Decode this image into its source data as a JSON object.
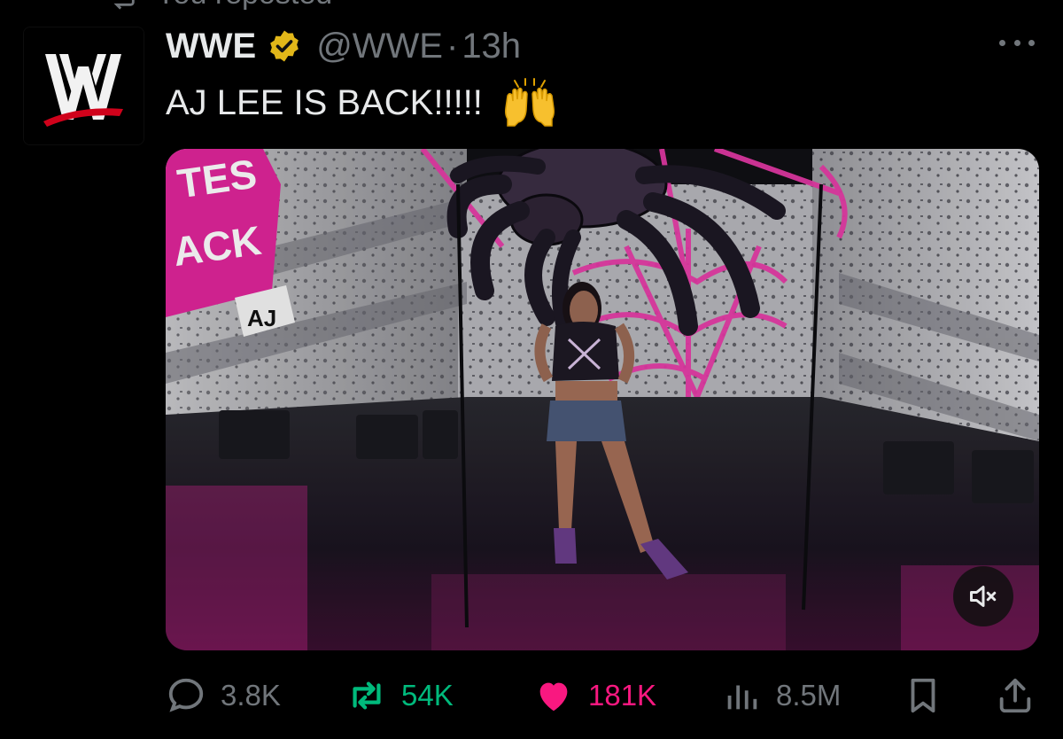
{
  "repost_banner": {
    "text": "You reposted"
  },
  "post": {
    "author_name": "WWE",
    "handle": "@WWE",
    "separator": "·",
    "time": "13h",
    "text": "AJ LEE IS BACK!!!!!",
    "emoji": "raising-hands",
    "media": {
      "type": "video",
      "muted": true,
      "sign_text_1": "TES",
      "sign_text_2": "ACK",
      "sign_text_3": "AJ"
    }
  },
  "actions": {
    "replies": "3.8K",
    "reposts": "54K",
    "likes": "181K",
    "views": "8.5M"
  },
  "colors": {
    "background": "#000000",
    "text_primary": "#e7e9ea",
    "text_secondary": "#71767b",
    "repost_active": "#00ba7c",
    "like_active": "#f91880",
    "verified_gold": "#e2b719",
    "wwe_red": "#d0021b"
  },
  "icons": [
    "repost-icon",
    "wwe-logo",
    "verified-badge-icon",
    "more-icon",
    "raising-hands-icon",
    "mute-icon",
    "reply-icon",
    "repost-icon",
    "heart-icon",
    "views-icon",
    "bookmark-icon",
    "share-icon"
  ]
}
